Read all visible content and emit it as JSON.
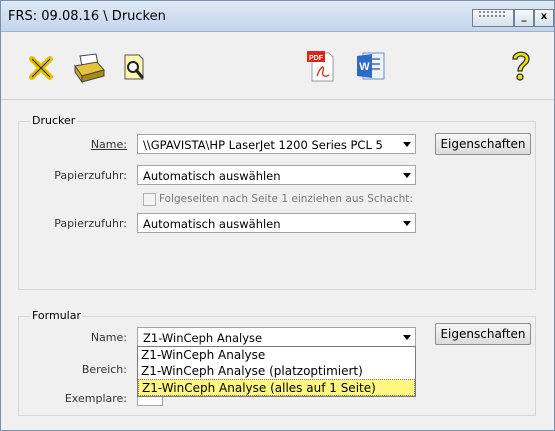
{
  "window": {
    "title": "FRS: 09.08.16 \\ Drucken",
    "buttons": {
      "menu": "",
      "minimize": "_",
      "close": "x"
    }
  },
  "toolbar": {
    "items": [
      {
        "name": "cancel-icon"
      },
      {
        "name": "print-icon"
      },
      {
        "name": "preview-icon"
      },
      {
        "name": "pdf-icon",
        "text": "PDF"
      },
      {
        "name": "word-icon",
        "text": "W"
      },
      {
        "name": "help-icon"
      }
    ],
    "colors": {
      "cancel": "#e3c000",
      "help": "#f2e400",
      "pdf": "#d9261c",
      "word": "#2b6bc5"
    }
  },
  "drucker": {
    "legend": "Drucker",
    "name_label": "Name:",
    "name_value": "\\\\GPAVISTA\\HP LaserJet 1200 Series PCL 5",
    "eigenschaften": "Eigenschaften",
    "papierzufuhr_label": "Papierzufuhr:",
    "papierzufuhr_value": "Automatisch auswählen",
    "folgeseiten_label": "Folgeseiten nach Seite 1 einziehen aus Schacht:",
    "papierzufuhr2_label": "Papierzufuhr:",
    "papierzufuhr2_value": "Automatisch auswählen"
  },
  "formular": {
    "legend": "Formular",
    "name_label": "Name:",
    "name_value": "Z1-WinCeph Analyse",
    "eigenschaften": "Eigenschaften",
    "bereich_label": "Bereich:",
    "exemplare_label": "Exemplare:",
    "dropdown_options": [
      "Z1-WinCeph Analyse",
      "Z1-WinCeph Analyse (platzoptimiert)",
      "Z1-WinCeph Analyse (alles auf 1 Seite)"
    ],
    "selected_index": 2
  }
}
